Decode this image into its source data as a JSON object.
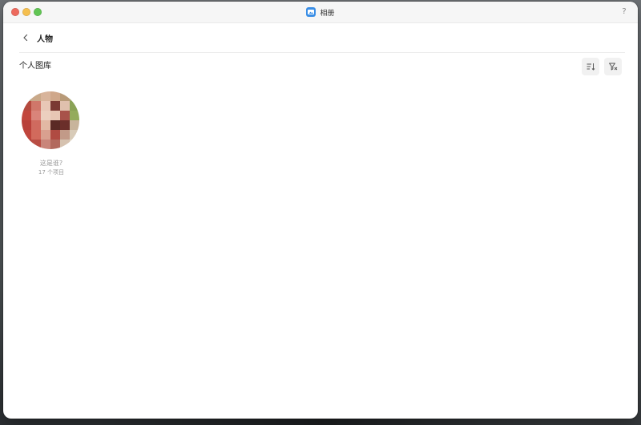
{
  "window": {
    "app_title": "相册",
    "help_label": "?"
  },
  "nav": {
    "title": "人物"
  },
  "section": {
    "title": "个人图库"
  },
  "toolbar": {
    "sort_icon": "sort-icon",
    "filter_icon": "filter-icon"
  },
  "people": [
    {
      "name": "这是谁?",
      "count": "17 个项目"
    }
  ],
  "colors": {
    "close": "#ed6a5e",
    "minimize": "#f5bf4f",
    "maximize": "#61c554",
    "app_accent": "#3a8ee6"
  }
}
